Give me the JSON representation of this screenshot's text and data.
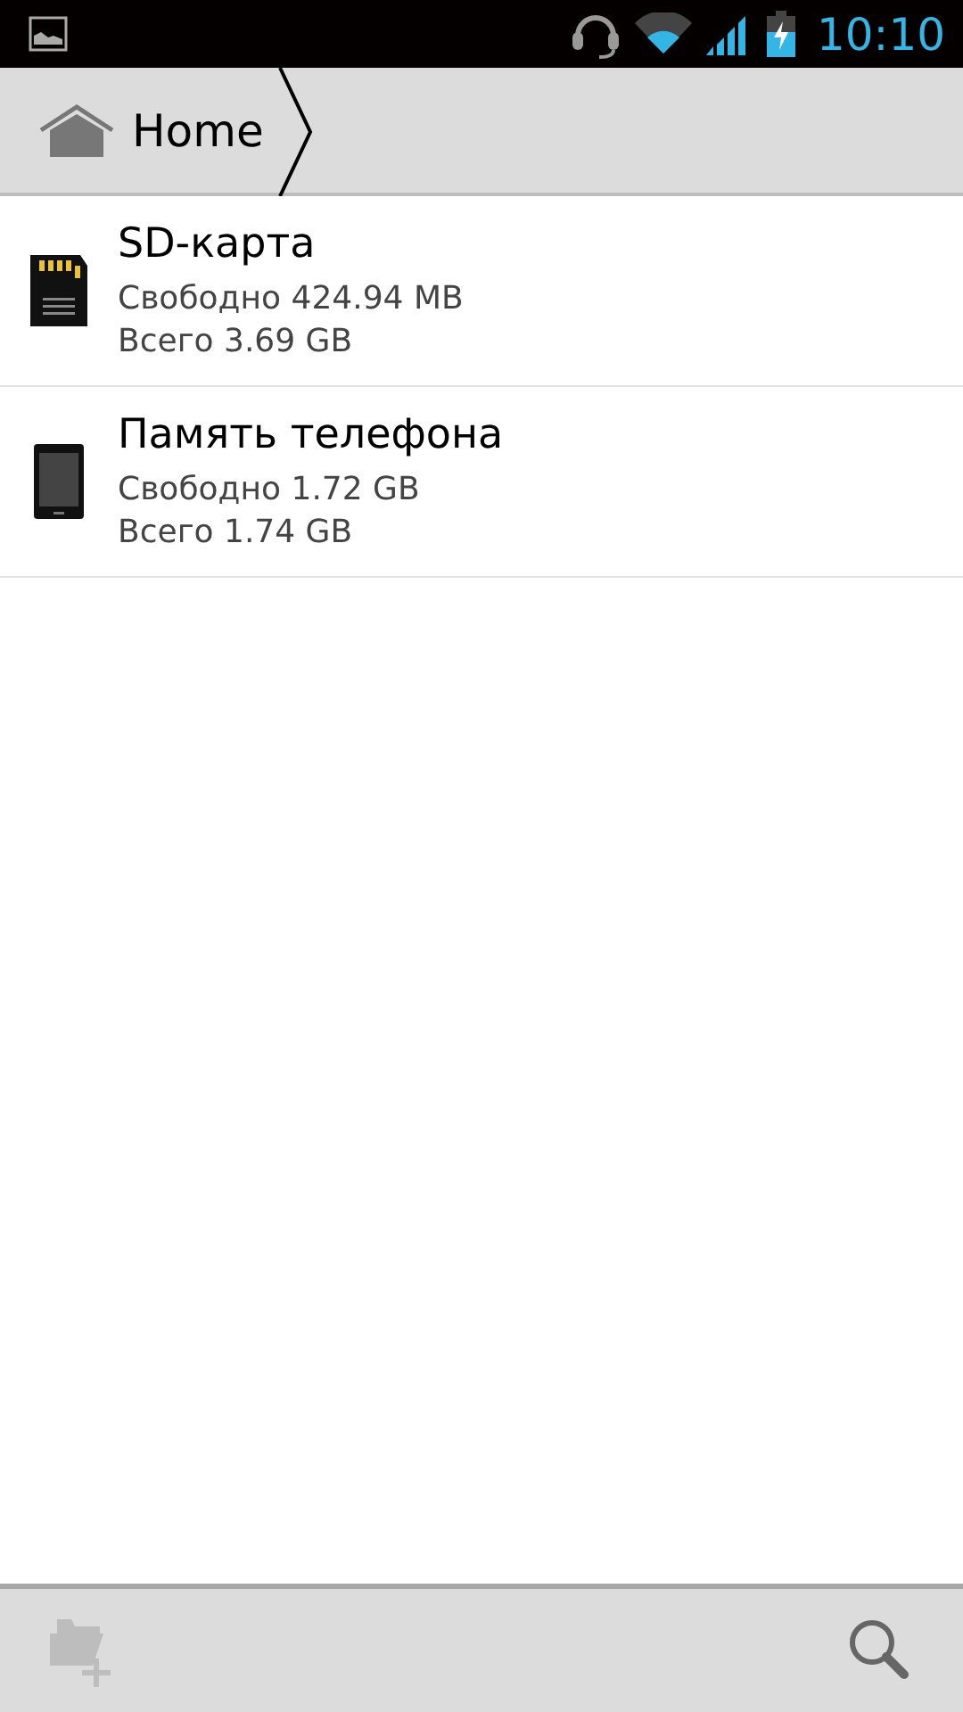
{
  "status_bar": {
    "time": "10:10"
  },
  "breadcrumb": {
    "items": [
      {
        "label": "Home",
        "kind": "home"
      }
    ]
  },
  "storage_list": [
    {
      "kind": "sd",
      "name": "SD-карта",
      "free": "Свободно 424.94 MB",
      "total": "Всего 3.69 GB"
    },
    {
      "kind": "phone",
      "name": "Память телефона",
      "free": "Свободно 1.72 GB",
      "total": "Всего 1.74 GB"
    }
  ],
  "toolbar": [
    {
      "kind": "new-folder",
      "disabled": true
    },
    {
      "kind": "search",
      "disabled": false
    }
  ]
}
